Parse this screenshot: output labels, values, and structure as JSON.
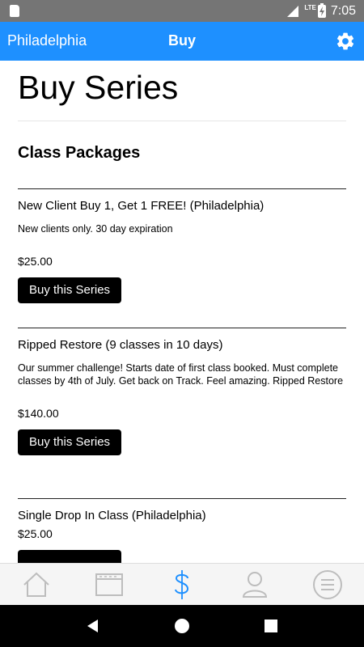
{
  "status_bar": {
    "network": "LTE",
    "time": "7:05"
  },
  "app_bar": {
    "location": "Philadelphia",
    "title": "Buy"
  },
  "page": {
    "title": "Buy Series",
    "section_title": "Class Packages"
  },
  "packages": [
    {
      "name": "New Client Buy 1, Get 1 FREE! (Philadelphia)",
      "description": "New clients only. 30 day expiration",
      "price": "$25.00",
      "button_label": "Buy this Series"
    },
    {
      "name": "Ripped Restore (9 classes in 10 days)",
      "description": "Our summer challenge! Starts date of first class booked. Must complete classes by 4th of July. Get back on Track. Feel amazing. Ripped Restore",
      "price": "$140.00",
      "button_label": "Buy this Series"
    },
    {
      "name": "Single Drop In Class (Philadelphia)",
      "price": "$25.00"
    }
  ],
  "bottom_nav": {
    "items": [
      "home-icon",
      "schedule-icon",
      "buy-icon",
      "profile-icon",
      "menu-icon"
    ],
    "active_color": "#1e90ff",
    "inactive_color": "#bdbdbd"
  },
  "colors": {
    "app_bar": "#1e90ff",
    "status_bar": "#757575"
  }
}
